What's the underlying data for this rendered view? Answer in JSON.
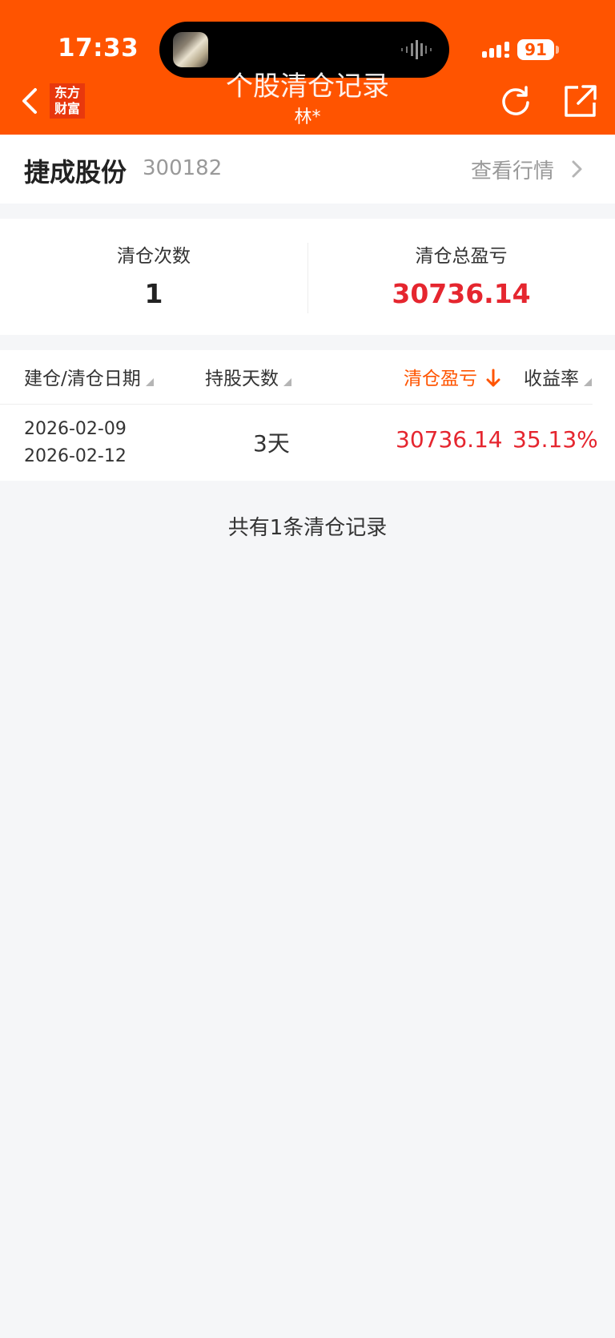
{
  "status_bar": {
    "time": "17:33",
    "battery": "91"
  },
  "header": {
    "logo": [
      "东方",
      "财富"
    ],
    "title": "个股清仓记录",
    "subtitle": "林*"
  },
  "stock": {
    "name": "捷成股份",
    "code": "300182",
    "view_quote_label": "查看行情"
  },
  "summary": {
    "count_label": "清仓次数",
    "count_value": "1",
    "total_label": "清仓总盈亏",
    "total_value": "30736.14"
  },
  "table": {
    "headers": [
      "建仓/清仓日期",
      "持股天数",
      "清仓盈亏",
      "收益率"
    ],
    "rows": [
      {
        "open_date": "2026-02-09",
        "close_date": "2026-02-12",
        "days": "3天",
        "pnl": "30736.14",
        "rate": "35.13%"
      }
    ]
  },
  "footer": {
    "text": "共有1条清仓记录"
  },
  "colors": {
    "accent": "#ff5400",
    "profit": "#e5262f",
    "background": "#f5f6f8"
  }
}
